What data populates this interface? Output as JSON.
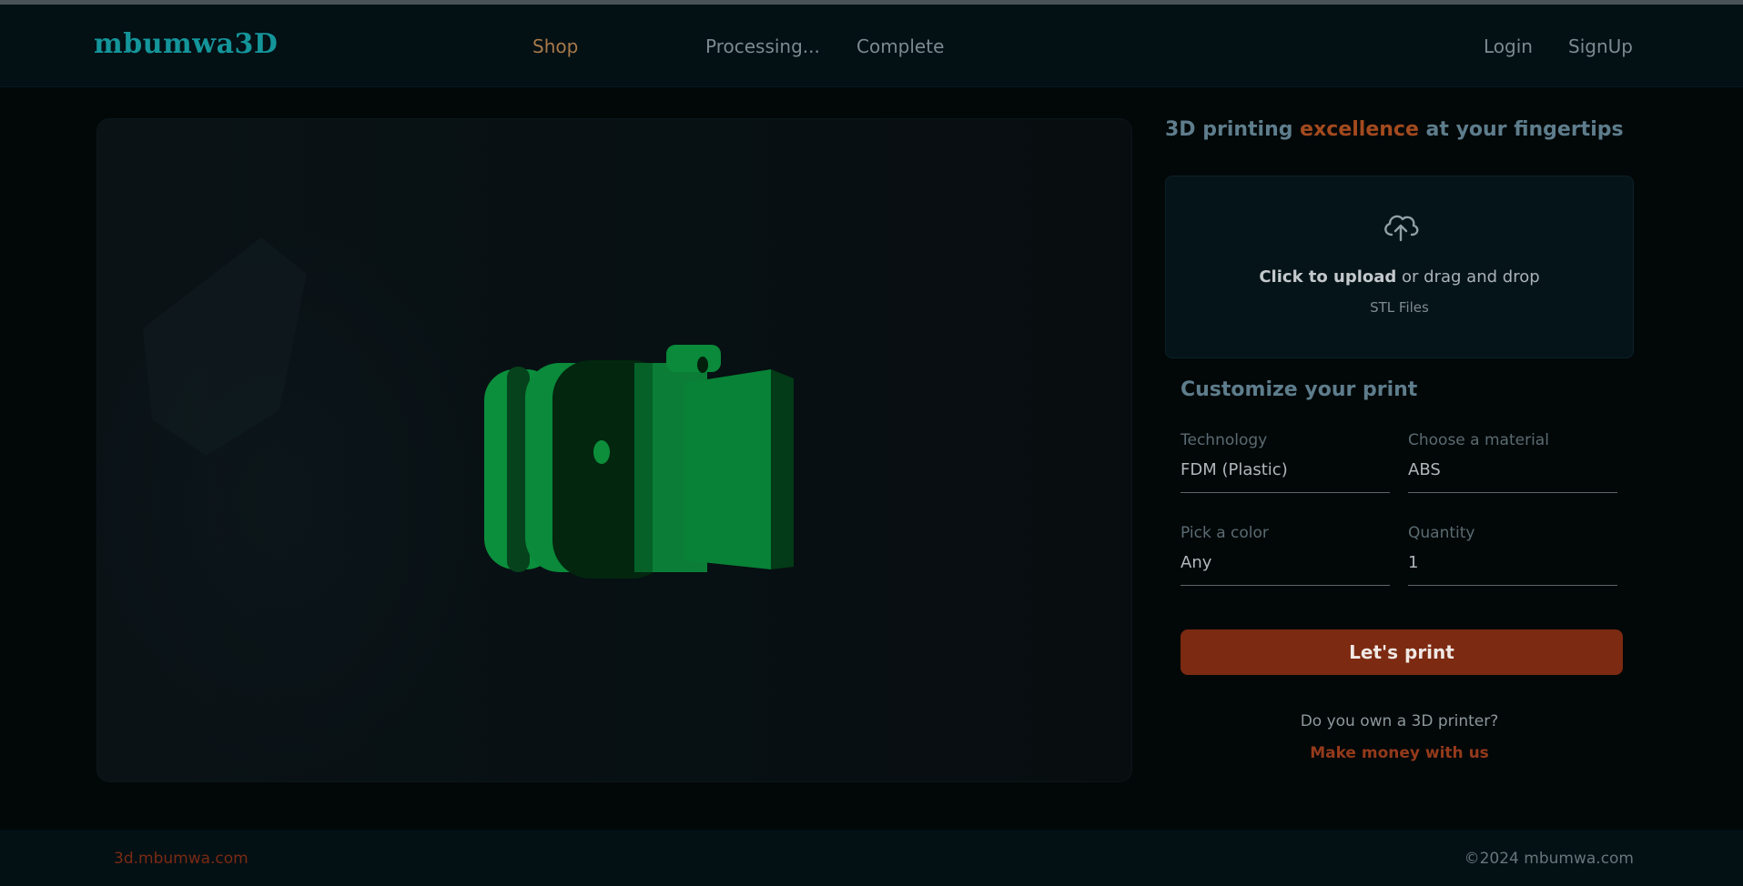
{
  "header": {
    "logo": "mbumwa3D",
    "nav": {
      "shop": "Shop",
      "processing": "Processing...",
      "complete": "Complete"
    },
    "auth": {
      "login": "Login",
      "signup": "SignUp"
    }
  },
  "headline": {
    "part1": "3D printing",
    "accent": "excellence",
    "part2": "at your fingertips"
  },
  "upload": {
    "icon": "cloud-upload-icon",
    "click_text": "Click to upload",
    "drag_text": "or drag and drop",
    "file_types": "STL Files"
  },
  "customize": {
    "title": "Customize your print",
    "technology": {
      "label": "Technology",
      "value": "FDM (Plastic)"
    },
    "material": {
      "label": "Choose a material",
      "value": "ABS"
    },
    "color": {
      "label": "Pick a color",
      "value": "Any"
    },
    "quantity": {
      "label": "Quantity",
      "value": "1"
    },
    "submit": "Let's print"
  },
  "promo": {
    "question": "Do you own a 3D printer?",
    "link": "Make money with us"
  },
  "footer": {
    "left": "3d.mbumwa.com",
    "right": "©2024 mbumwa.com"
  },
  "colors": {
    "brand": "#14959a",
    "accent": "#a34a1e",
    "button": "#7c2a11",
    "model": "#0a7a33"
  }
}
